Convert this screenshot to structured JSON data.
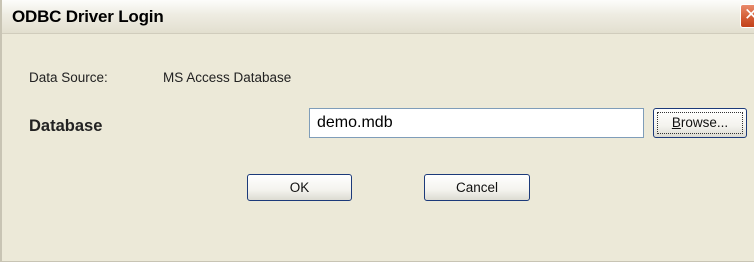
{
  "window": {
    "title": "ODBC Driver Login",
    "close_glyph": "✕"
  },
  "data_source": {
    "label": "Data Source:",
    "value": "MS Access Database"
  },
  "database": {
    "label": "Database",
    "value": "demo.mdb",
    "browse_label_mnemonic": "B",
    "browse_label_rest": "rowse..."
  },
  "buttons": {
    "ok_label": "OK",
    "cancel_label": "Cancel"
  },
  "colors": {
    "dialog_bg": "#ece9d8",
    "close_button": "#d25a33",
    "input_border": "#7f9db9",
    "button_border": "#1c3a7a"
  },
  "icons": {
    "close": "close-icon"
  }
}
